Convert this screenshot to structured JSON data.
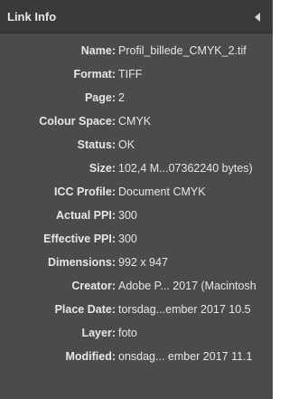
{
  "header": {
    "title": "Link Info",
    "collapse_icon": "triangle-left-icon"
  },
  "colors": {
    "panel_bg": "#4b4b4b",
    "header_bg": "#3a3a3a",
    "text": "#e6e6e6"
  },
  "rows": [
    {
      "label": "Name:",
      "value": "Profil_billede_CMYK_2.tif"
    },
    {
      "label": "Format:",
      "value": "TIFF"
    },
    {
      "label": "Page:",
      "value": "2"
    },
    {
      "label": "Colour Space:",
      "value": "CMYK"
    },
    {
      "label": "Status:",
      "value": "OK"
    },
    {
      "label": "Size:",
      "value": "102,4 M...07362240 bytes)"
    },
    {
      "label": "ICC Profile:",
      "value": "Document CMYK"
    },
    {
      "label": "Actual PPI:",
      "value": "300"
    },
    {
      "label": "Effective PPI:",
      "value": "300"
    },
    {
      "label": "Dimensions:",
      "value": "992 x 947"
    },
    {
      "label": "Creator:",
      "value": "Adobe P... 2017 (Macintosh"
    },
    {
      "label": "Place Date:",
      "value": "torsdag...ember 2017 10.5"
    },
    {
      "label": "Layer:",
      "value": "foto"
    },
    {
      "label": "Modified:",
      "value": "onsdag... ember 2017 11.1"
    }
  ]
}
